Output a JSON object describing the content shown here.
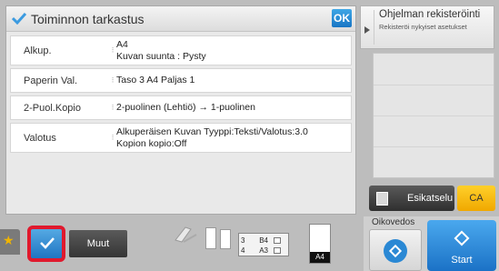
{
  "panel": {
    "title": "Toiminnon tarkastus",
    "ok_label": "OK",
    "rows": [
      {
        "label": "Alkup.",
        "value_lines": [
          "A4",
          "Kuvan suunta : Pysty"
        ]
      },
      {
        "label": "Paperin Val.",
        "value_lines": [
          "Taso 3  A4  Paljas 1"
        ]
      },
      {
        "label": "2-Puol.Kopio",
        "value_lines": [
          "2-puolinen (Lehtiö) → 1-puolinen"
        ]
      },
      {
        "label": "Valotus",
        "value_lines": [
          "Alkuperäisen Kuvan Tyyppi:Teksti/Valotus:3.0",
          "Kopion kopio:Off"
        ]
      }
    ]
  },
  "program": {
    "title": "Ohjelman rekisteröinti",
    "subtitle": "Rekisteröi nykyiset asetukset"
  },
  "buttons": {
    "preview": "Esikatselu",
    "ca": "CA",
    "oikovedos": "Oikovedos",
    "start": "Start",
    "muut": "Muut"
  },
  "status": {
    "trays": [
      {
        "num": "3",
        "size": "B4"
      },
      {
        "num": "4",
        "size": "A3"
      }
    ],
    "output_size": "A4"
  },
  "colors": {
    "accent_blue": "#1f75c2",
    "highlight_red": "#e0192d",
    "ca_yellow": "#f0a800"
  }
}
